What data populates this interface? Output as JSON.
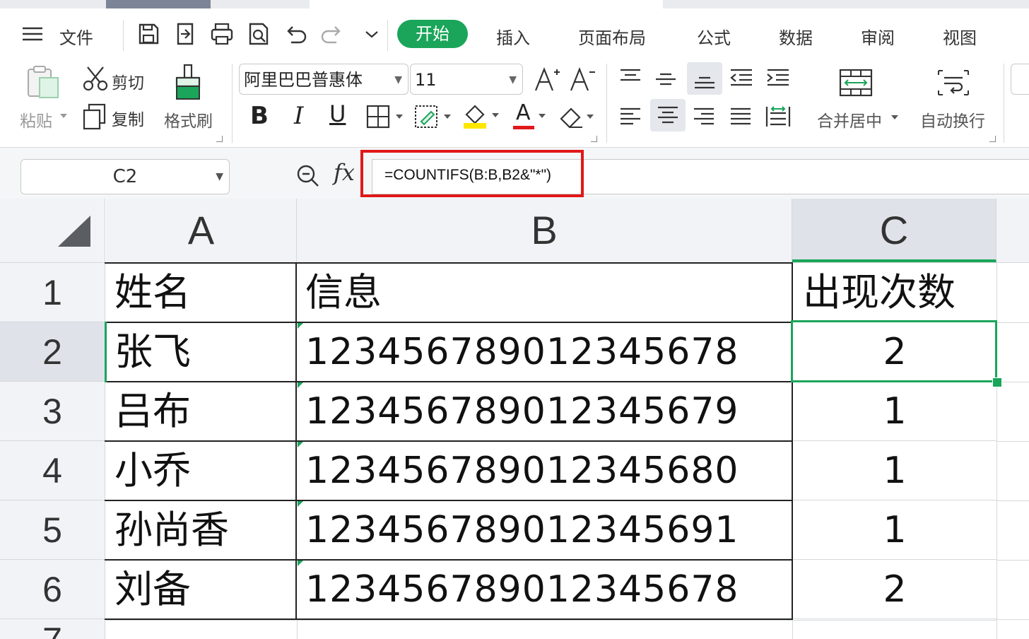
{
  "menu": {
    "file_label": "文件",
    "tabs": [
      "开始",
      "插入",
      "页面布局",
      "公式",
      "数据",
      "审阅",
      "视图"
    ]
  },
  "ribbon": {
    "paste_label": "粘贴",
    "cut_label": "剪切",
    "copy_label": "复制",
    "format_painter_label": "格式刷",
    "font_name": "阿里巴巴普惠体",
    "font_size": "11",
    "merge_center_label": "合并居中",
    "wrap_text_label": "自动换行",
    "bold_glyph": "B",
    "italic_glyph": "I",
    "underline_glyph": "U",
    "font_color_glyph": "A"
  },
  "formula_bar": {
    "cell_ref": "C2",
    "fx_label": "fx",
    "formula": "=COUNTIFS(B:B,B2&\"*\")"
  },
  "sheet": {
    "columns": [
      "A",
      "B",
      "C"
    ],
    "selected_column": "C",
    "selected_row": "2",
    "rows": [
      {
        "num": "1",
        "a": "姓名",
        "b": "信息",
        "c": "出现次数"
      },
      {
        "num": "2",
        "a": "张飞",
        "b": "12345678901234567​8",
        "c": "2"
      },
      {
        "num": "3",
        "a": "吕布",
        "b": "123456789012345679",
        "c": "1"
      },
      {
        "num": "4",
        "a": "小乔",
        "b": "123456789012345680",
        "c": "1"
      },
      {
        "num": "5",
        "a": "孙尚香",
        "b": "123456789012345691",
        "c": "1"
      },
      {
        "num": "6",
        "a": "刘备",
        "b": "123456789012345678",
        "c": "2"
      }
    ],
    "partial_row": "7"
  },
  "colors": {
    "accent": "#1aa55a",
    "highlight_box": "#e01818"
  }
}
